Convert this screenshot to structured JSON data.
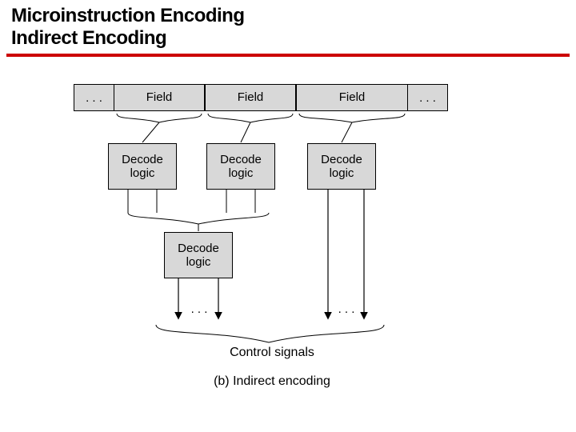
{
  "title_line1": "Microinstruction Encoding",
  "title_line2": "Indirect Encoding",
  "ellipsis": ". . .",
  "fields": {
    "f1": "Field",
    "f2": "Field",
    "f3": "Field"
  },
  "decoders": {
    "d1": "Decode\nlogic",
    "d2": "Decode\nlogic",
    "d3": "Decode\nlogic",
    "d4": "Decode\nlogic"
  },
  "signals_label": "Control signals",
  "caption": "(b) Indirect encoding"
}
